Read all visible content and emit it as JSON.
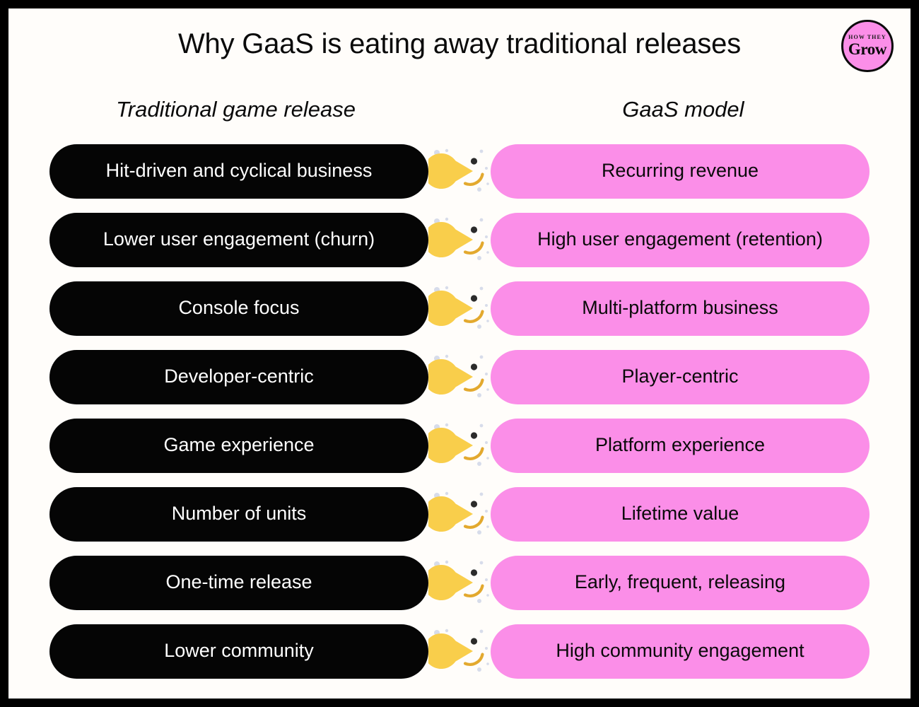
{
  "page": {
    "title": "Why GaaS is eating away traditional releases",
    "background_color": "#FFFDFA",
    "border_color": "#000000"
  },
  "brand": {
    "name": "brand-logo",
    "top_text": "HOW THEY",
    "main_text": "Grow",
    "circle_color": "#FB8EE8",
    "text_color": "#0A0A0A"
  },
  "columns": {
    "left_header": "Traditional game release",
    "middle_header": "",
    "right_header": "GaaS model"
  },
  "colors": {
    "traditional_pill": "#050505",
    "traditional_text": "#FFFFFF",
    "gaas_pill": "#FB8EE8",
    "gaas_text": "#0A0A0A",
    "pacman_body": "#F9CE4B",
    "pacman_eye": "#2B2B2B",
    "pacman_smile": "#E3A92E",
    "food_dot": "#6FA85A",
    "decor_dot": "#D7DCEA"
  },
  "icons": {
    "connector": "pacman-icon",
    "food": "dot-icon"
  },
  "rows": [
    {
      "traditional": "Hit-driven and cyclical business",
      "gaas": "Recurring revenue"
    },
    {
      "traditional": "Lower user engagement (churn)",
      "gaas": "High user engagement (retention)"
    },
    {
      "traditional": "Console focus",
      "gaas": "Multi-platform business"
    },
    {
      "traditional": "Developer-centric",
      "gaas": "Player-centric"
    },
    {
      "traditional": "Game experience",
      "gaas": "Platform experience"
    },
    {
      "traditional": "Number of units",
      "gaas": "Lifetime value"
    },
    {
      "traditional": "One-time release",
      "gaas": "Early, frequent, releasing"
    },
    {
      "traditional": "Lower community",
      "gaas": "High community engagement"
    }
  ]
}
